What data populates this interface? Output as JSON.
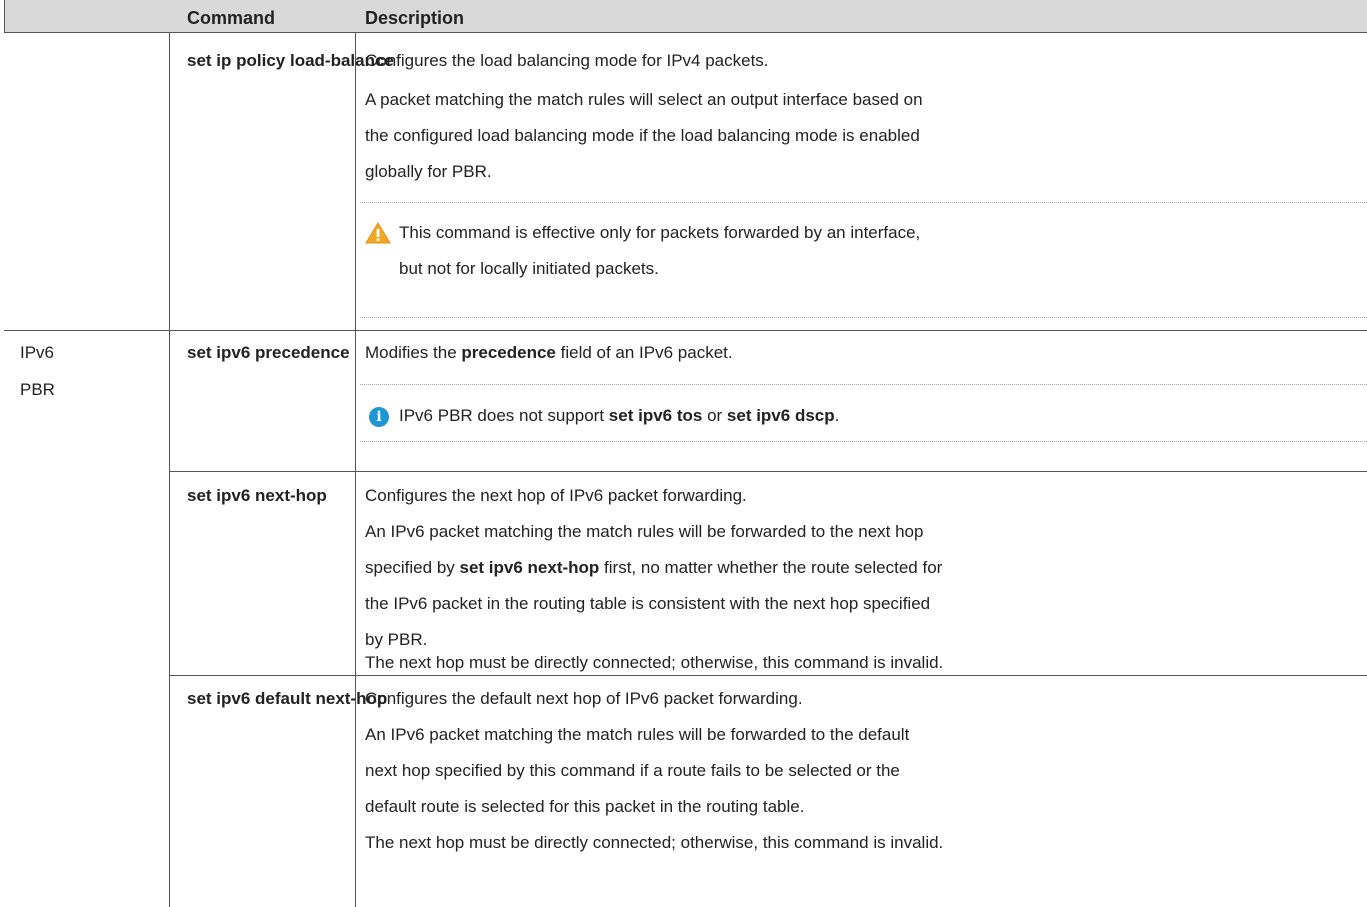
{
  "header": {
    "command": "Command",
    "description": "Description"
  },
  "row1": {
    "command": "set ip policy load-balance",
    "desc_line1": "Configures the load balancing mode for IPv4 packets.",
    "desc_line2": "A packet matching the match rules will select an output interface based on",
    "desc_line3": "the configured load balancing mode if the load balancing mode is enabled",
    "desc_line4": "globally for PBR.",
    "warning_line1": "This command is effective only for packets forwarded by an interface,",
    "warning_line2": "but not for locally initiated packets."
  },
  "group": {
    "line1": "IPv6",
    "line2": "PBR"
  },
  "row2": {
    "command": "set ipv6 precedence",
    "desc_pre": "Modifies the ",
    "desc_bold": "precedence",
    "desc_post": " field of an IPv6 packet.",
    "note_pre": "IPv6 PBR does not support ",
    "note_bold1": "set ipv6 tos",
    "note_mid": " or ",
    "note_bold2": "set ipv6 dscp",
    "note_post": "."
  },
  "row3": {
    "command": "set ipv6 next-hop",
    "desc_line1": "Configures the next hop of IPv6 packet forwarding.",
    "desc_line2": "An IPv6 packet matching the match rules will be forwarded to the next hop",
    "desc_line3_pre": "specified by ",
    "desc_line3_bold": "set ipv6 next-hop",
    "desc_line3_post": " first, no matter whether the route selected for",
    "desc_line4": "the IPv6 packet in the routing table is consistent with the next hop specified",
    "desc_line5": "by PBR.",
    "desc_line6": "The next hop must be directly connected; otherwise, this command is invalid."
  },
  "row4": {
    "command": "set ipv6 default next-hop",
    "desc_line1": "Configures the default next hop of IPv6 packet forwarding.",
    "desc_line2": "An IPv6 packet matching the match rules will be forwarded to the default",
    "desc_line3": "next hop specified by this command if a route fails to be selected or the",
    "desc_line4": "default route is selected for this packet in the routing table.",
    "desc_line5": "The next hop must be directly connected; otherwise, this command is invalid."
  },
  "colors": {
    "header_bg": "#d9d9d9",
    "border": "#555555",
    "warning": "#f5a623",
    "info": "#1f97d4"
  }
}
